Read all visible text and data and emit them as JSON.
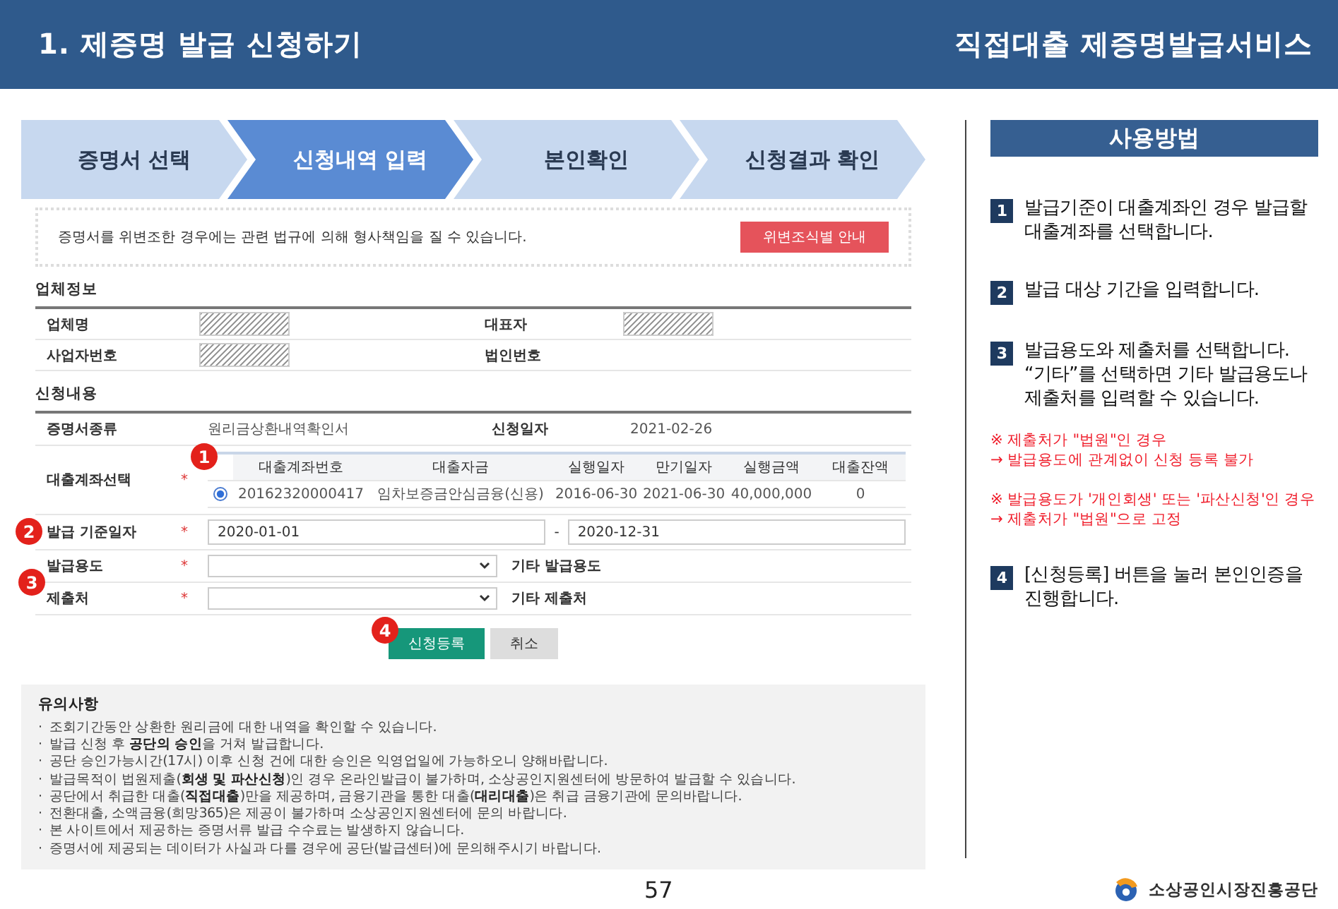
{
  "header": {
    "title": "1. 제증명 발급 신청하기",
    "service": "직접대출 제증명발급서비스"
  },
  "steps": [
    {
      "label": "증명서 선택",
      "selected": false
    },
    {
      "label": "신청내역 입력",
      "selected": true
    },
    {
      "label": "본인확인",
      "selected": false
    },
    {
      "label": "신청결과 확인",
      "selected": false
    }
  ],
  "form": {
    "warning": {
      "text": "증명서를 위변조한 경우에는 관련 법규에 의해 형사책임을 질 수 있습니다.",
      "button": "위변조식별 안내"
    },
    "company": {
      "title": "업체정보",
      "fields": [
        {
          "label": "업체명",
          "redacted": true
        },
        {
          "label": "대표자",
          "redacted": true
        },
        {
          "label": "사업자번호",
          "redacted": true
        },
        {
          "label": "법인번호",
          "redacted": false
        }
      ]
    },
    "application": {
      "title": "신청내용",
      "required_mark": "*",
      "rows": [
        {
          "kind": "pair",
          "label": "증명서종류",
          "value": "원리금상환내역확인서",
          "label2": "신청일자",
          "value2": "2021-02-26"
        },
        {
          "kind": "account",
          "label": "대출계좌선택",
          "required": true,
          "marker": "1",
          "columns": [
            "대출계좌번호",
            "대출자금",
            "실행일자",
            "만기일자",
            "실행금액",
            "대출잔액"
          ],
          "rows": [
            {
              "selected": true,
              "cells": [
                "20162320000417",
                "임차보증금안심금융(신용)",
                "2016-06-30",
                "2021-06-30",
                "40,000,000",
                "0"
              ]
            }
          ]
        },
        {
          "kind": "period",
          "label": "발급 기준일자",
          "required": true,
          "marker": "2",
          "from": "2020-01-01",
          "separator": "-",
          "to": "2020-12-31"
        },
        {
          "kind": "select",
          "label": "발급용도",
          "required": true,
          "marker": "3",
          "label2": "기타 발급용도"
        },
        {
          "kind": "select",
          "label": "제출처",
          "required": true,
          "label2": "기타 제출처"
        }
      ]
    },
    "actions": {
      "marker": "4",
      "submit": "신청등록",
      "cancel": "취소"
    }
  },
  "notes": {
    "title": "유의사항",
    "bullet": "·",
    "items": [
      "조회기간동안 상환한 원리금에 대한 내역을 확인할 수 있습니다.",
      "발급 신청 후 **공단의 승인**을 거쳐 발급합니다.",
      "공단 승인가능시간(17시) 이후 신청 건에 대한 승인은 익영업일에 가능하오니 양해바랍니다.",
      "발급목적이 법원제출(**회생 및 파산신청**)인 경우 온라인발급이 불가하며, 소상공인지원센터에 방문하여 발급할 수 있습니다.",
      "공단에서 취급한 대출(**직접대출**)만을 제공하며, 금융기관을 통한 대출(**대리대출**)은 취급 금융기관에 문의바랍니다.",
      "전환대출, 소액금융(희망365)은 제공이 불가하며 소상공인지원센터에 문의 바랍니다.",
      "본 사이트에서 제공하는 증명서류 발급 수수료는 발생하지 않습니다.",
      "증명서에 제공되는 데이터가 사실과 다를 경우에 공단(발급센터)에 문의해주시기 바랍니다."
    ]
  },
  "guide": {
    "title": "사용방법",
    "items": [
      {
        "kind": "step",
        "number": "1",
        "text": "발급기준이 대출계좌인 경우 발급할 대출계좌를 선택합니다."
      },
      {
        "kind": "step",
        "number": "2",
        "text": "발급 대상 기간을 입력합니다."
      },
      {
        "kind": "step",
        "number": "3",
        "text": "발급용도와 제출처를 선택합니다. “기타”를 선택하면 기타 발급용도나 제출처를 입력할 수 있습니다."
      },
      {
        "kind": "note",
        "lines": [
          "※ 제출처가 \"법원\"인 경우",
          "→ 발급용도에 관계없이 신청 등록 불가"
        ]
      },
      {
        "kind": "note",
        "lines": [
          "※ 발급용도가 '개인회생' 또는 '파산신청'인 경우",
          "→ 제출처가 \"법원\"으로 고정"
        ]
      },
      {
        "kind": "step",
        "number": "4",
        "text": "[신청등록] 버튼을 눌러 본인인증을 진행합니다."
      }
    ]
  },
  "page_number": "57",
  "footer": {
    "organization": "소상공인시장진흥공단"
  }
}
